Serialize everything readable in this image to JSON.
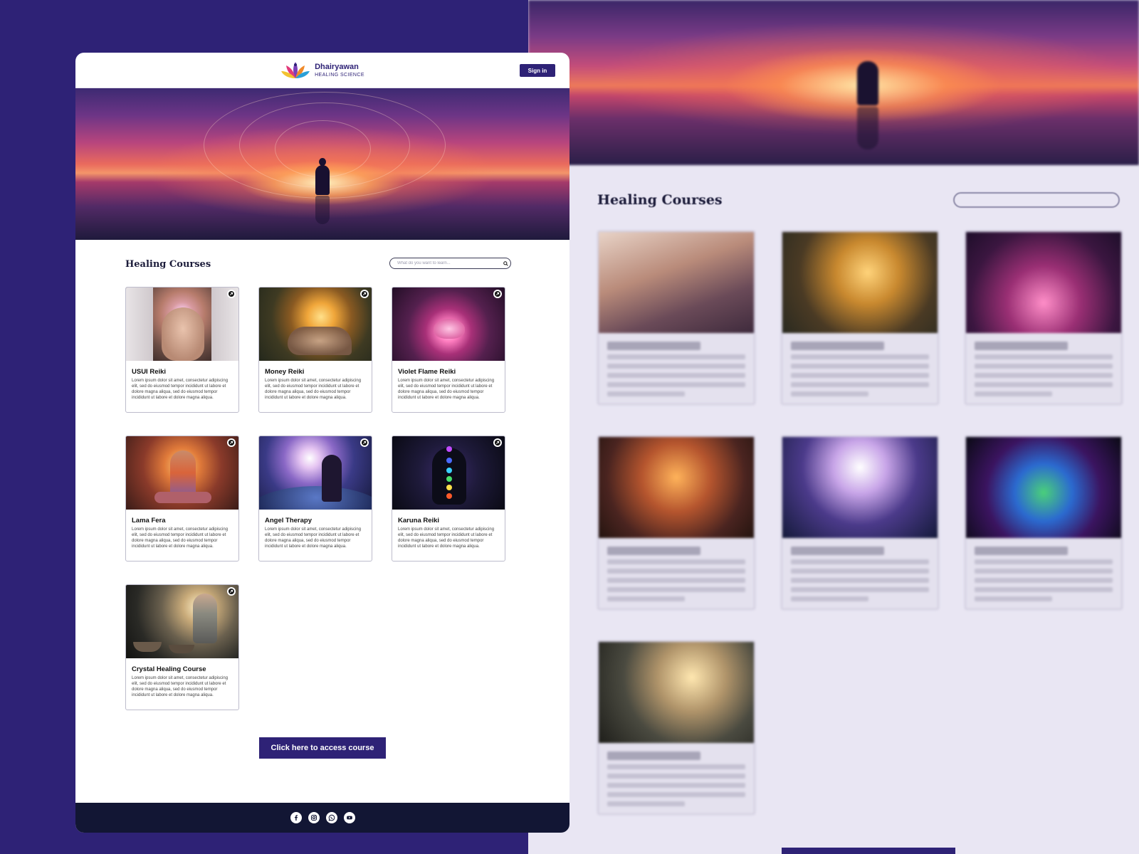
{
  "brand": {
    "name": "Dhairyawan",
    "tagline": "HEALING SCIENCE"
  },
  "header": {
    "signin_label": "Sign in"
  },
  "courses": {
    "title": "Healing Courses",
    "search_placeholder": "What do you want to learn...",
    "items": [
      {
        "name": "USUI Reiki",
        "description": "Lorem ipsum dolor sit amet, consectetur adipiscing elit, sed do eiusmod tempor incididunt ut labore et dolore magna aliqua, sed do eiusmod tempor incididunt ut labore et dolore magna aliqua."
      },
      {
        "name": "Money Reiki",
        "description": "Lorem ipsum dolor sit amet, consectetur adipiscing elit, sed do eiusmod tempor incididunt ut labore et dolore magna aliqua, sed do eiusmod tempor incididunt ut labore et dolore magna aliqua."
      },
      {
        "name": "Violet Flame Reiki",
        "description": "Lorem ipsum dolor sit amet, consectetur adipiscing elit, sed do eiusmod tempor incididunt ut labore et dolore magna aliqua, sed do eiusmod tempor incididunt ut labore et dolore magna aliqua."
      },
      {
        "name": "Lama Fera",
        "description": "Lorem ipsum dolor sit amet, consectetur adipiscing elit, sed do eiusmod tempor incididunt ut labore et dolore magna aliqua, sed do eiusmod tempor incididunt ut labore et dolore magna aliqua."
      },
      {
        "name": "Angel Therapy",
        "description": "Lorem ipsum dolor sit amet, consectetur adipiscing elit, sed do eiusmod tempor incididunt ut labore et dolore magna aliqua, sed do eiusmod tempor incididunt ut labore et dolore magna aliqua."
      },
      {
        "name": "Karuna Reiki",
        "description": "Lorem ipsum dolor sit amet, consectetur adipiscing elit, sed do eiusmod tempor incididunt ut labore et dolore magna aliqua, sed do eiusmod tempor incididunt ut labore et dolore magna aliqua."
      },
      {
        "name": "Crystal Healing Course",
        "description": "Lorem ipsum dolor sit amet, consectetur adipiscing elit, sed do eiusmod tempor incididunt ut labore et dolore magna aliqua, sed do eiusmod tempor incididunt ut labore et dolore magna aliqua."
      }
    ]
  },
  "cta": {
    "label": "Click here to access course"
  },
  "footer": {
    "social_icons": [
      "facebook-icon",
      "instagram-icon",
      "whatsapp-icon",
      "youtube-icon"
    ]
  },
  "colors": {
    "brand_primary": "#2e2276",
    "footer_bg": "#121634",
    "zoom_panel_bg": "#e9e6f3"
  }
}
